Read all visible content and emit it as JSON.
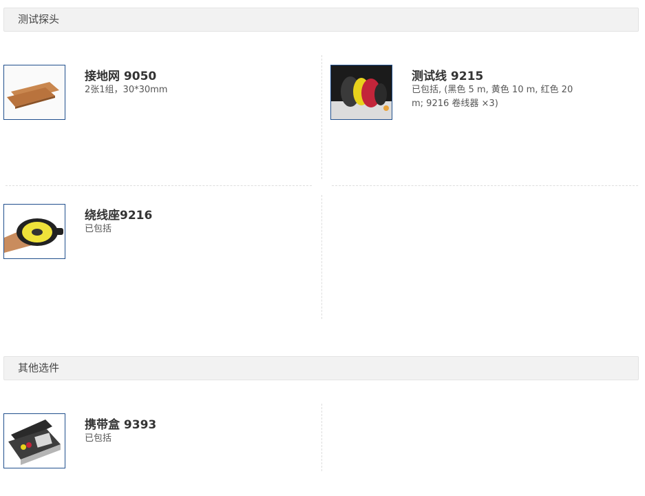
{
  "sections": [
    {
      "title": "测试探头",
      "items": [
        {
          "name": "接地网 9050",
          "desc": "2张1组，30*30mm",
          "icon": "ground-net-icon"
        },
        {
          "name": "测试线 9215",
          "desc": "已包括, (黑色 5 m, 黄色 10 m, 红色 20 m; 9216 卷线器 ×3)",
          "icon": "test-lead-set-icon"
        },
        {
          "name": "绕线座9216",
          "desc": "已包括",
          "icon": "cable-reel-icon"
        }
      ]
    },
    {
      "title": "其他选件",
      "items": [
        {
          "name": "携带盒 9393",
          "desc": "已包括",
          "icon": "carrying-case-icon"
        }
      ]
    }
  ],
  "colors": {
    "header_bg": "#f2f2f2",
    "thumb_border": "#1f4e8c",
    "divider": "#dddddd"
  }
}
